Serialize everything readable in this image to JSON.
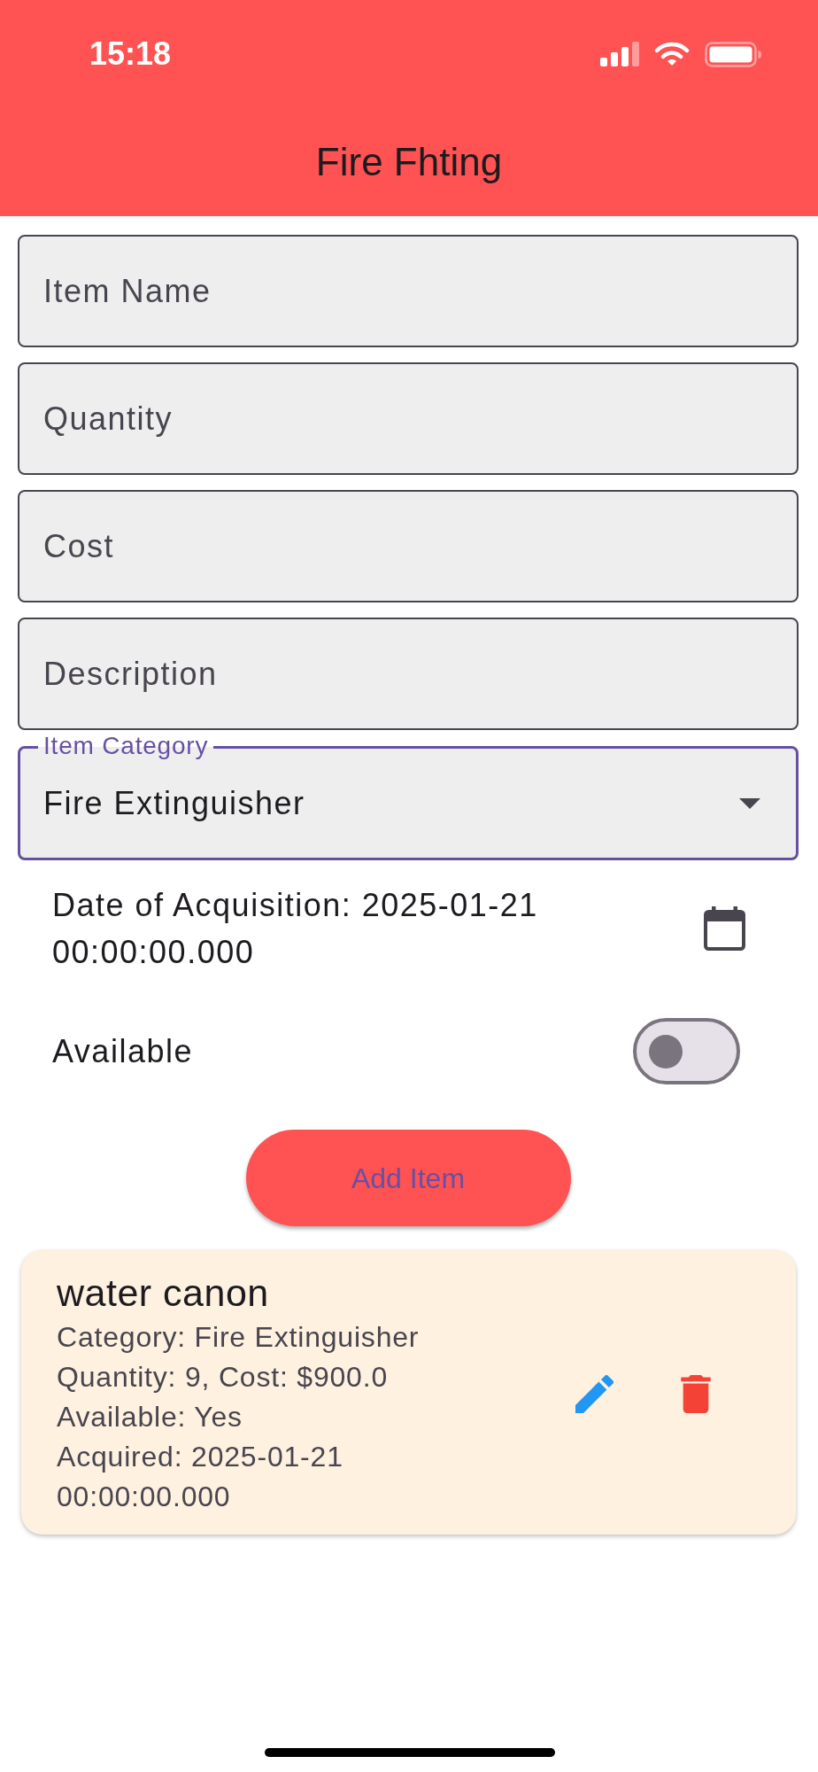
{
  "status_bar": {
    "time": "15:18"
  },
  "app_bar": {
    "title": "Fire Fhting"
  },
  "form": {
    "fields": [
      {
        "placeholder": "Item Name"
      },
      {
        "placeholder": "Quantity"
      },
      {
        "placeholder": "Cost"
      },
      {
        "placeholder": "Description"
      }
    ],
    "category": {
      "label": "Item Category",
      "value": "Fire Extinguisher",
      "focused": true
    },
    "date": {
      "text": "Date of Acquisition: 2025-01-21 00:00:00.000"
    },
    "available": {
      "label": "Available",
      "on": false
    },
    "submit": {
      "label": "Add Item"
    }
  },
  "items": [
    {
      "name": "water canon",
      "details": [
        "Category: Fire Extinguisher",
        "Quantity: 9, Cost: $900.0",
        "Available: Yes",
        "Acquired: 2025-01-21 00:00:00.000"
      ]
    }
  ]
}
